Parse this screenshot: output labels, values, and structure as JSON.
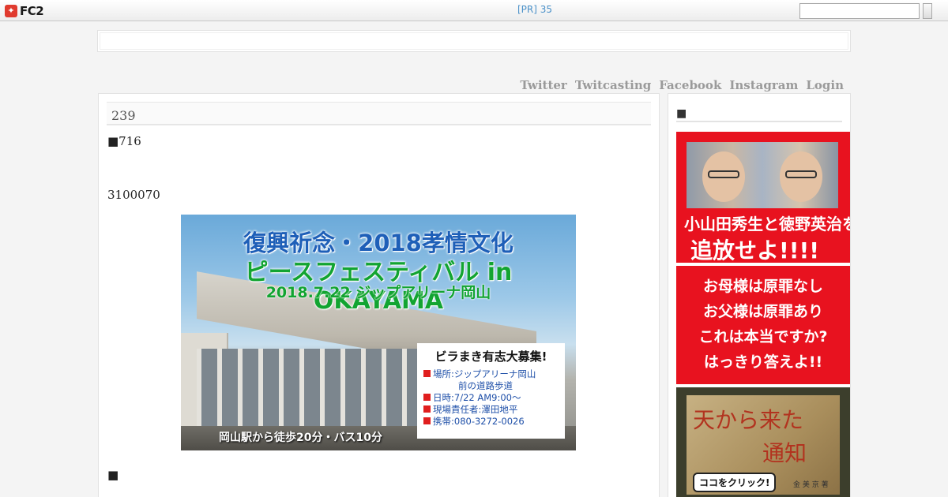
{
  "topbar": {
    "logo_text": "FC2",
    "pr_text": "[PR] 35",
    "search_placeholder": ""
  },
  "nav": {
    "items": [
      "Twitter",
      "Twitcasting",
      "Facebook",
      "Instagram",
      "Login"
    ]
  },
  "entry": {
    "title": "239",
    "line1": "■716",
    "line2": "3100070",
    "line3": "■"
  },
  "banner": {
    "title_line1": "復興祈念・2018孝情文化",
    "title_line2": "ピースフェスティバル in OKAYAMA",
    "date_line": "2018.7.22 ジップアリーナ岡山",
    "caption": "岡山駅から徒歩20分・バス10分",
    "notice_title": "ビラまき有志大募集!",
    "notice_rows": [
      "場所:ジップアリーナ岡山",
      "前の道路歩道",
      "日時:7/22 AM9:00〜",
      "現場責任者:澤田地平",
      "携帯:080-3272-0026"
    ],
    "colors": {
      "title_blue": "#1e5fb8",
      "title_green": "#12a431",
      "bullet_red": "#e01e1e"
    }
  },
  "sidebar": {
    "title": "■",
    "ad1": {
      "caption1": "小山田秀生と徳野英治を",
      "caption2": "追放せよ!!!!"
    },
    "ad2": {
      "lines": [
        "お母様は原罪なし",
        "お父様は原罪あり",
        "これは本当ですか?",
        "はっきり答えよ!!"
      ]
    },
    "ad3": {
      "title1": "天から来た",
      "title2": "通知",
      "button": "ココをクリック!",
      "author": "金 美 京 著"
    }
  }
}
